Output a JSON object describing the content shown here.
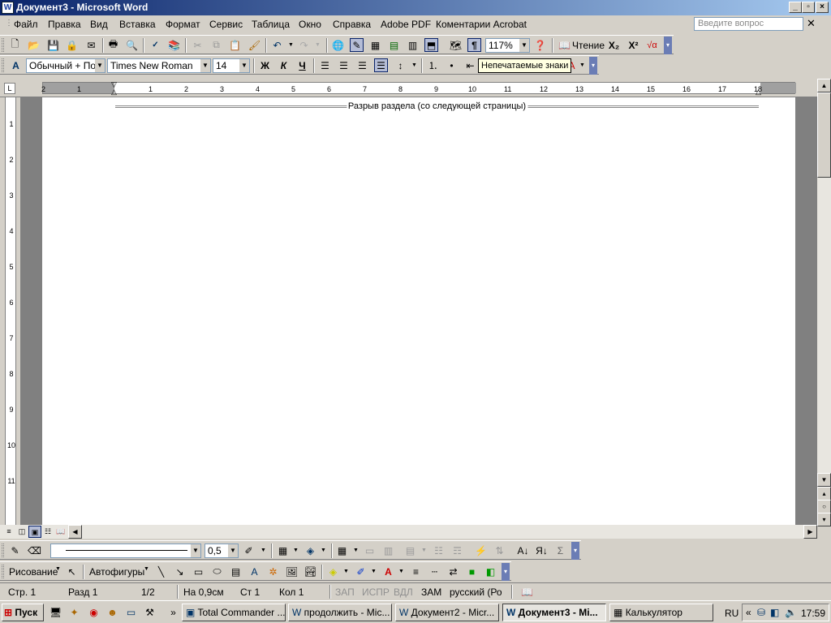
{
  "window": {
    "title": "Документ3 - Microsoft Word",
    "app_icon": "W"
  },
  "menu": {
    "items": [
      "Файл",
      "Правка",
      "Вид",
      "Вставка",
      "Формат",
      "Сервис",
      "Таблица",
      "Окно",
      "Справка",
      "Adobe PDF",
      "Коментарии Acrobat"
    ],
    "ask_placeholder": "Введите вопрос"
  },
  "standard_toolbar": {
    "zoom": "117%",
    "reading_label": "Чтение"
  },
  "formatting_toolbar": {
    "style": "Обычный + По ц",
    "font": "Times New Roman",
    "size": "14",
    "bold": "Ж",
    "italic": "К",
    "underline": "Ч"
  },
  "tooltip": {
    "text": "Непечатаемые знаки"
  },
  "ruler": {
    "h_ticks": [
      "2",
      "1",
      "1",
      "2",
      "3",
      "4",
      "5",
      "6",
      "7",
      "8",
      "9",
      "10",
      "11",
      "12",
      "13",
      "14",
      "15",
      "16",
      "17",
      "18"
    ],
    "v_ticks": [
      "1",
      "2",
      "3",
      "4",
      "5",
      "6",
      "7",
      "8",
      "9",
      "10",
      "11"
    ]
  },
  "document": {
    "section_break": "Разрыв раздела (со следующей страницы)"
  },
  "drawing_toolbar": {
    "line_width": "0,5",
    "drawing_label": "Рисование",
    "autoshapes_label": "Автофигуры"
  },
  "status": {
    "page": "Стр. 1",
    "section": "Разд 1",
    "pages": "1/2",
    "at": "На 0,9см",
    "line": "Ст 1",
    "col": "Кол 1",
    "rec": "ЗАП",
    "trk": "ИСПР",
    "ext": "ВДЛ",
    "ovr": "ЗАМ",
    "language": "русский (Ро"
  },
  "taskbar": {
    "start": "Пуск",
    "buttons": [
      "Total Commander ...",
      "продолжить - Mic...",
      "Документ2 - Micr...",
      "Документ3 - Mi...",
      "Калькулятор"
    ],
    "active_index": 3,
    "lang": "RU",
    "clock": "17:59"
  }
}
